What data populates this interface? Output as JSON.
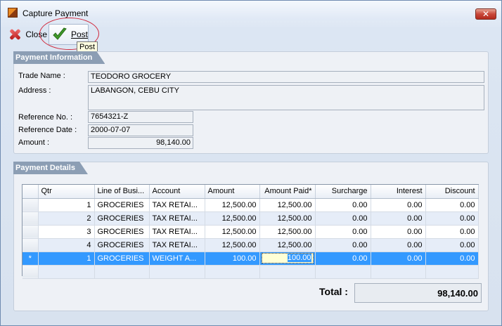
{
  "window": {
    "title": "Capture Payment",
    "close_glyph": "✕"
  },
  "toolbar": {
    "close_label": "Close",
    "post_label": "Post",
    "tooltip": "Post"
  },
  "payment_info": {
    "heading": "Payment Information",
    "trade_name_label": "Trade Name :",
    "trade_name": "TEODORO GROCERY",
    "address_label": "Address :",
    "address": "LABANGON, CEBU CITY",
    "reference_no_label": "Reference No. :",
    "reference_no": "7654321-Z",
    "reference_date_label": "Reference Date :",
    "reference_date": "2000-07-07",
    "amount_label": "Amount :",
    "amount": "98,140.00"
  },
  "payment_details": {
    "heading": "Payment Details",
    "columns": [
      "Qtr",
      "Line of Busi...",
      "Account",
      "Amount",
      "Amount Paid*",
      "Surcharge",
      "Interest",
      "Discount"
    ],
    "rows": [
      {
        "ind": "",
        "qtr": "1",
        "line": "GROCERIES",
        "account": "TAX RETAI...",
        "amount": "12,500.00",
        "paid": "12,500.00",
        "surcharge": "0.00",
        "interest": "0.00",
        "discount": "0.00"
      },
      {
        "ind": "",
        "qtr": "2",
        "line": "GROCERIES",
        "account": "TAX RETAI...",
        "amount": "12,500.00",
        "paid": "12,500.00",
        "surcharge": "0.00",
        "interest": "0.00",
        "discount": "0.00"
      },
      {
        "ind": "",
        "qtr": "3",
        "line": "GROCERIES",
        "account": "TAX RETAI...",
        "amount": "12,500.00",
        "paid": "12,500.00",
        "surcharge": "0.00",
        "interest": "0.00",
        "discount": "0.00"
      },
      {
        "ind": "",
        "qtr": "4",
        "line": "GROCERIES",
        "account": "TAX RETAI...",
        "amount": "12,500.00",
        "paid": "12,500.00",
        "surcharge": "0.00",
        "interest": "0.00",
        "discount": "0.00"
      },
      {
        "ind": "*",
        "qtr": "1",
        "line": "GROCERIES",
        "account": "WEIGHT A...",
        "amount": "100.00",
        "paid": "100.00",
        "surcharge": "0.00",
        "interest": "0.00",
        "discount": "0.00"
      }
    ],
    "total_label": "Total :",
    "total": "98,140.00"
  }
}
